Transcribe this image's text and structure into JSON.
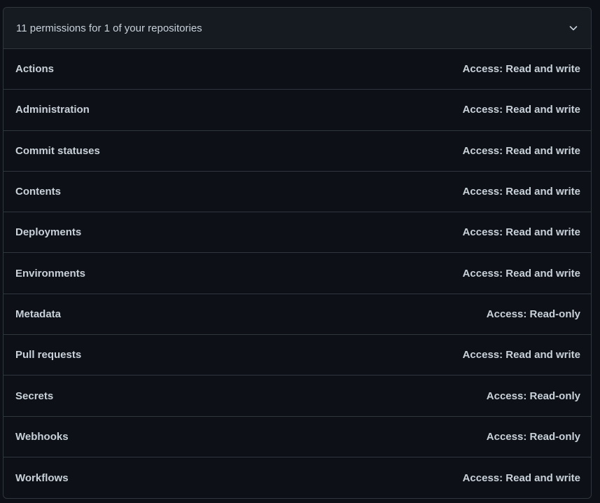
{
  "panel": {
    "title": "11 permissions for 1 of your repositories",
    "toggle_icon": "chevron-down-icon"
  },
  "permissions": [
    {
      "name": "Actions",
      "access": "Access: Read and write"
    },
    {
      "name": "Administration",
      "access": "Access: Read and write"
    },
    {
      "name": "Commit statuses",
      "access": "Access: Read and write"
    },
    {
      "name": "Contents",
      "access": "Access: Read and write"
    },
    {
      "name": "Deployments",
      "access": "Access: Read and write"
    },
    {
      "name": "Environments",
      "access": "Access: Read and write"
    },
    {
      "name": "Metadata",
      "access": "Access: Read-only"
    },
    {
      "name": "Pull requests",
      "access": "Access: Read and write"
    },
    {
      "name": "Secrets",
      "access": "Access: Read-only"
    },
    {
      "name": "Webhooks",
      "access": "Access: Read-only"
    },
    {
      "name": "Workflows",
      "access": "Access: Read and write"
    }
  ],
  "colors": {
    "background": "#0d1117",
    "header_background": "#161b22",
    "border": "#30363d",
    "text": "#c9d1d9"
  }
}
